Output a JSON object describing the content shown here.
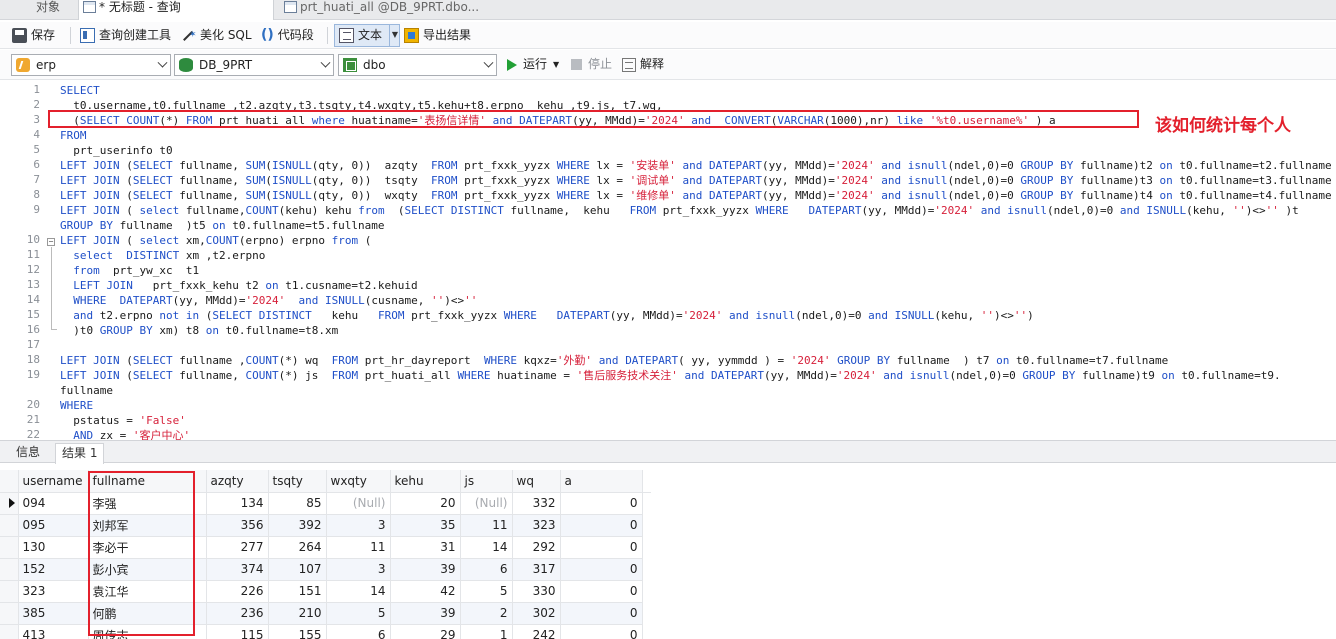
{
  "tabs": {
    "objects": "对象",
    "query": "* 无标题 - 查询",
    "table": "prt_huati_all @DB_9PRT.dbo..."
  },
  "toolbar": {
    "save": "保存",
    "query_builder": "查询创建工具",
    "beautify": "美化 SQL",
    "snippet_icon": "()",
    "snippet": "代码段",
    "text": "文本",
    "export": "导出结果"
  },
  "toolbar2": {
    "connection": "erp",
    "database": "DB_9PRT",
    "schema": "dbo",
    "run": "运行",
    "stop": "停止",
    "explain": "解释"
  },
  "editor": {
    "line_numbers": [
      "1",
      "2",
      "3",
      "4",
      "5",
      "6",
      "7",
      "8",
      "9",
      "10",
      "11",
      "12",
      "13",
      "14",
      "15",
      "16",
      "17",
      "18",
      "19",
      "20",
      "21",
      "22"
    ],
    "lines": [
      "SELECT",
      "  t0.username,t0.fullname ,t2.azqty,t3.tsqty,t4.wxqty,t5.kehu+t8.erpno  kehu ,t9.js, t7.wq,",
      "  (SELECT COUNT(*) FROM prt_huati_all where huatiname='表扬信详情' and DATEPART(yy, MMdd)='2024' and  CONVERT(VARCHAR(1000),nr) like '%t0.username%' ) a",
      "FROM",
      "  prt_userinfo t0",
      "LEFT JOIN (SELECT fullname, SUM(ISNULL(qty, 0))  azqty  FROM prt_fxxk_yyzx WHERE lx = '安装单' and DATEPART(yy, MMdd)='2024' and isnull(ndel,0)=0 GROUP BY fullname)t2 on t0.fullname=t2.fullname",
      "LEFT JOIN (SELECT fullname, SUM(ISNULL(qty, 0))  tsqty  FROM prt_fxxk_yyzx WHERE lx = '调试单' and DATEPART(yy, MMdd)='2024' and isnull(ndel,0)=0 GROUP BY fullname)t3 on t0.fullname=t3.fullname",
      "LEFT JOIN (SELECT fullname, SUM(ISNULL(qty, 0))  wxqty  FROM prt_fxxk_yyzx WHERE lx = '维修单' and DATEPART(yy, MMdd)='2024' and isnull(ndel,0)=0 GROUP BY fullname)t4 on t0.fullname=t4.fullname",
      "LEFT JOIN ( select fullname,COUNT(kehu) kehu from  (SELECT DISTINCT fullname,  kehu   FROM prt_fxxk_yyzx WHERE   DATEPART(yy, MMdd)='2024' and isnull(ndel,0)=0 and ISNULL(kehu, '')<>'' )t",
      "GROUP BY fullname  )t5 on t0.fullname=t5.fullname",
      "LEFT JOIN ( select xm,COUNT(erpno) erpno from (",
      "  select  DISTINCT xm ,t2.erpno",
      "  from  prt_yw_xc  t1",
      "  LEFT JOIN   prt_fxxk_kehu t2 on t1.cusname=t2.kehuid",
      "  WHERE  DATEPART(yy, MMdd)='2024'  and ISNULL(cusname, '')<>''",
      "  and t2.erpno not in (SELECT DISTINCT   kehu   FROM prt_fxxk_yyzx WHERE   DATEPART(yy, MMdd)='2024' and isnull(ndel,0)=0 and ISNULL(kehu, '')<>'')",
      "  )t0 GROUP BY xm) t8 on t0.fullname=t8.xm",
      "",
      "LEFT JOIN (SELECT fullname ,COUNT(*) wq  FROM prt_hr_dayreport  WHERE kqxz='外勤' and DATEPART( yy, yymmdd ) = '2024' GROUP BY fullname  ) t7 on t0.fullname=t7.fullname",
      "LEFT JOIN (SELECT fullname, COUNT(*) js  FROM prt_huati_all WHERE huatiname = '售后服务技术关注' and DATEPART(yy, MMdd)='2024' and isnull(ndel,0)=0 GROUP BY fullname)t9 on t0.fullname=t9.",
      "fullname",
      "WHERE",
      "  pstatus = 'False'",
      "  AND zx = '客户中心'"
    ],
    "annotation": "该如何统计每个人"
  },
  "results": {
    "tab_info": "信息",
    "tab_result": "结果 1",
    "columns": [
      "username",
      "fullname",
      "azqty",
      "tsqty",
      "wxqty",
      "kehu",
      "js",
      "wq",
      "a"
    ],
    "rows": [
      [
        "094",
        "李强",
        "134",
        "85",
        "(Null)",
        "20",
        "(Null)",
        "332",
        "0"
      ],
      [
        "095",
        "刘邦军",
        "356",
        "392",
        "3",
        "35",
        "11",
        "323",
        "0"
      ],
      [
        "130",
        "李必干",
        "277",
        "264",
        "11",
        "31",
        "14",
        "292",
        "0"
      ],
      [
        "152",
        "彭小宾",
        "374",
        "107",
        "3",
        "39",
        "6",
        "317",
        "0"
      ],
      [
        "323",
        "袁江华",
        "226",
        "151",
        "14",
        "42",
        "5",
        "330",
        "0"
      ],
      [
        "385",
        "何鹏",
        "236",
        "210",
        "5",
        "39",
        "2",
        "302",
        "0"
      ],
      [
        "413",
        "周传志",
        "115",
        "155",
        "6",
        "29",
        "1",
        "242",
        "0"
      ]
    ]
  },
  "colors": {
    "keyword": "#1f4fc8",
    "string": "#d6203a",
    "annotation": "#e3202c",
    "run": "#22a035"
  },
  "icons": {
    "save": "save-icon",
    "query_builder": "query-builder-icon",
    "beautify": "magic-wand-icon",
    "snippet": "parentheses-icon",
    "text": "text-mode-icon",
    "export": "export-icon",
    "run": "play-icon",
    "stop": "stop-icon",
    "explain": "explain-icon"
  }
}
